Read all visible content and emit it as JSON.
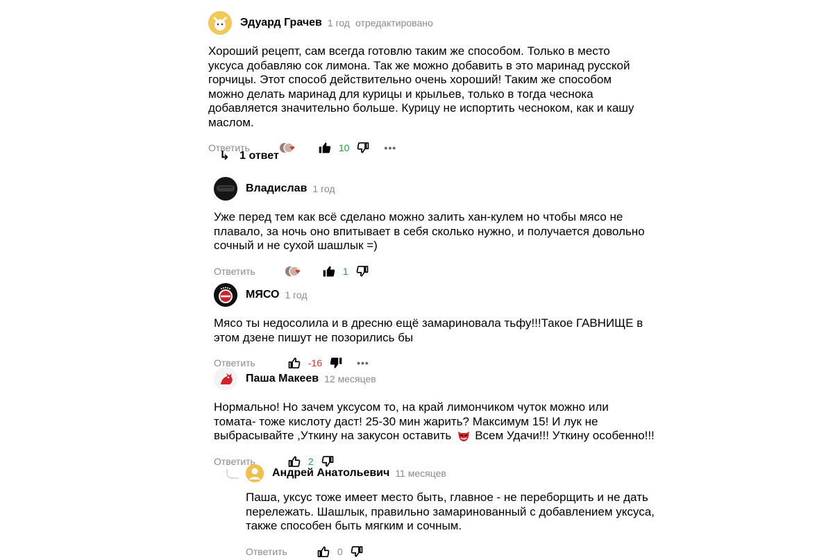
{
  "comments": [
    {
      "author": "Эдуард Грачев",
      "time": "1 год",
      "edited": "отредактировано",
      "lines": [
        "Хороший рецепт, сам всегда готовлю таким же способом. Только в место",
        "уксуса добавляю сок лимона. Так же можно добавить в это маринад русской",
        "горчицы. Этот способ действительно очень хороший! Таким же способом",
        "можно делать маринад для курицы и крыльев, только в тогда чеснока",
        "добавляется значительно больше. Курицу не испортить чесноком, как и кашу",
        "маслом."
      ],
      "reply_label": "Ответить",
      "likes": "10",
      "more": "•••"
    },
    {
      "author": "Владислав",
      "time": "1 год",
      "lines": [
        "Уже перед тем как всё сделано можно залить хан-кулем но чтобы мясо не",
        "плавало, за ночь оно впитывает в себя сколько нужно, и получается довольно",
        "сочный и не сухой шашлык =)"
      ],
      "reply_label": "Ответить",
      "likes": "1"
    },
    {
      "author": "МЯСО",
      "time": "1 год",
      "lines": [
        "Мясо ты недосолила и в дресню ещё замариновала тьфу!!!Такое ГАВНИЩЕ в",
        "этом дзене пишут не позорились бы"
      ],
      "reply_label": "Ответить",
      "likes": "-16",
      "more": "•••"
    },
    {
      "author": "Паша Макеев",
      "time": "12 месяцев",
      "lines": [
        "Нормально! Но зачем уксусом то, на край лимончиком чуток можно или",
        "томата- тоже кислоту даст! 25-30 мин жарить? Максимум 15! И лук не",
        "выбрасывайте ,Уткину на закусон оставить",
        "Всем Удачи!!! Уткину особенно!!!"
      ],
      "reply_label": "Ответить",
      "likes": "2"
    },
    {
      "author": "Андрей Анатольевич",
      "time": "11 месяцев",
      "lines": [
        "Паша, уксус тоже имеет место быть, главное - не переборщить и не дать",
        "перележать. Шашлык, правильно замаринованный с добавлением уксуса,",
        "также способен быть мягким и сочным."
      ],
      "reply_label": "Ответить",
      "likes": "0"
    }
  ],
  "replies_toggle": {
    "arrow": "↳",
    "label": "1 ответ"
  },
  "colors": {
    "positive": "#24a23a",
    "negative": "#e0302b",
    "muted": "#8a8a8a"
  }
}
